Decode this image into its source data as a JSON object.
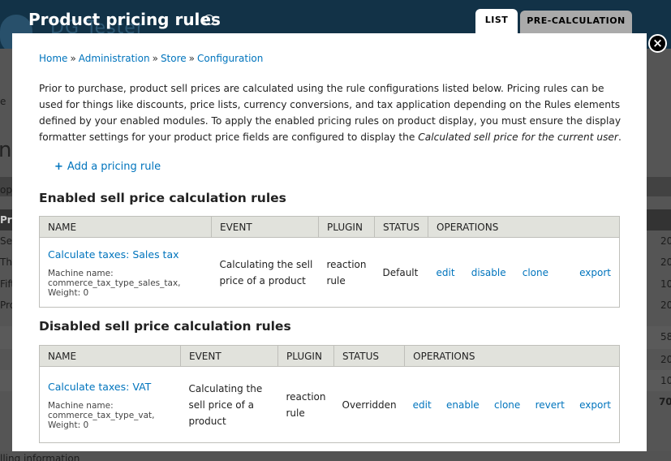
{
  "background": {
    "site_name": "DG Tester",
    "left_fragments": [
      "e",
      "ne",
      "op",
      "Pro",
      "Sek",
      "Thi",
      "Fift",
      "Pro"
    ],
    "right_fragments": [
      "20",
      "20",
      "10",
      "20",
      "58",
      "20",
      "10",
      "70"
    ],
    "bottom_fragment": "lling information"
  },
  "overlay": {
    "title": "Product pricing rules",
    "tabs": [
      {
        "label": "LIST",
        "active": true
      },
      {
        "label": "PRE-CALCULATION",
        "active": false
      }
    ],
    "close_label": "×"
  },
  "breadcrumb": [
    "Home",
    "Administration",
    "Store",
    "Configuration"
  ],
  "breadcrumb_separator": "»",
  "intro": {
    "text": "Prior to purchase, product sell prices are calculated using the rule configurations listed below. Pricing rules can be used for things like discounts, price lists, currency conversions, and tax application depending on the Rules elements defined by your enabled modules. To apply the enabled pricing rules on product display, you must ensure the display formatter settings for your product price fields are configured to display the ",
    "emphasis": "Calculated sell price for the current user",
    "end": "."
  },
  "add_rule": {
    "icon": "plus-icon",
    "label": "Add a pricing rule"
  },
  "enabled": {
    "title": "Enabled sell price calculation rules",
    "headers": [
      "NAME",
      "EVENT",
      "PLUGIN",
      "STATUS",
      "OPERATIONS"
    ],
    "rows": [
      {
        "name": "Calculate taxes: Sales tax",
        "machine_label": "Machine name:",
        "machine_name": "commerce_tax_type_sales_tax,",
        "weight": "Weight: 0",
        "event": "Calculating the sell price of a product",
        "plugin": "reaction rule",
        "status": "Default",
        "operations": [
          "edit",
          "disable",
          "clone",
          "export"
        ]
      }
    ]
  },
  "disabled": {
    "title": "Disabled sell price calculation rules",
    "headers": [
      "NAME",
      "EVENT",
      "PLUGIN",
      "STATUS",
      "OPERATIONS"
    ],
    "rows": [
      {
        "name": "Calculate taxes: VAT",
        "machine_label": "Machine name:",
        "machine_name": "commerce_tax_type_vat,",
        "weight": "Weight: 0",
        "event": "Calculating the sell price of a product",
        "plugin": "reaction rule",
        "status": "Overridden",
        "operations": [
          "edit",
          "enable",
          "clone",
          "revert",
          "export"
        ]
      }
    ]
  }
}
